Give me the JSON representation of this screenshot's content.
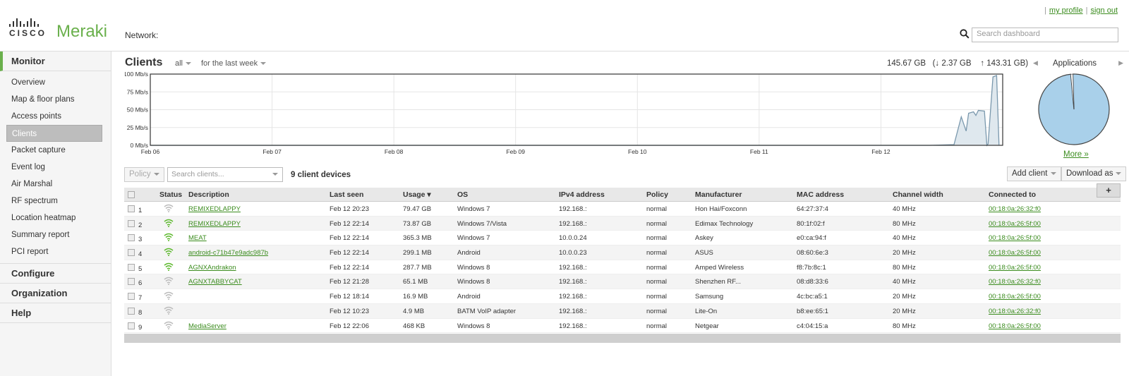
{
  "header": {
    "logo_word": "CISCO",
    "product": "Meraki",
    "network_label": "Network:",
    "my_profile": "my profile",
    "sign_out": "sign out",
    "search_placeholder": "Search dashboard"
  },
  "sidebar": {
    "monitor": "Monitor",
    "items": [
      {
        "label": "Overview"
      },
      {
        "label": "Map & floor plans"
      },
      {
        "label": "Access points"
      },
      {
        "label": "Clients",
        "active": true
      },
      {
        "label": "Packet capture"
      },
      {
        "label": "Event log"
      },
      {
        "label": "Air Marshal"
      },
      {
        "label": "RF spectrum"
      },
      {
        "label": "Location heatmap"
      },
      {
        "label": "Summary report"
      },
      {
        "label": "PCI report"
      }
    ],
    "configure": "Configure",
    "organization": "Organization",
    "help": "Help"
  },
  "main": {
    "title": "Clients",
    "filter_all": "all",
    "filter_time": "for the last week",
    "total_usage": "145.67 GB",
    "down_usage": "(↓ 2.37 GB",
    "up_usage": "↑ 143.31 GB)",
    "apps_title": "Applications",
    "more_link": "More »",
    "policy_btn": "Policy",
    "search_placeholder": "Search clients...",
    "client_count": "9 client devices",
    "add_client": "Add client",
    "download_as": "Download as"
  },
  "colors": {
    "accent": "#6ab04c",
    "link": "#3b8c1e",
    "chart_fill": "#dfe8ee",
    "chart_line": "#7a98ad",
    "pie_fill": "#a9d0ea"
  },
  "chart_data": {
    "type": "area",
    "ylabel_ticks": [
      "100 Mb/s",
      "75 Mb/s",
      "50 Mb/s",
      "25 Mb/s",
      "0 Mb/s"
    ],
    "ylim": [
      0,
      100
    ],
    "x_ticks": [
      "Feb 06",
      "Feb 07",
      "Feb 08",
      "Feb 09",
      "Feb 10",
      "Feb 11",
      "Feb 12"
    ],
    "x_range_days": [
      6.0,
      13.0
    ],
    "points": [
      {
        "day": 6.0,
        "mbps": 0
      },
      {
        "day": 12.4,
        "mbps": 0
      },
      {
        "day": 12.6,
        "mbps": 1
      },
      {
        "day": 12.66,
        "mbps": 40
      },
      {
        "day": 12.7,
        "mbps": 20
      },
      {
        "day": 12.72,
        "mbps": 45
      },
      {
        "day": 12.76,
        "mbps": 47
      },
      {
        "day": 12.78,
        "mbps": 42
      },
      {
        "day": 12.8,
        "mbps": 49
      },
      {
        "day": 12.85,
        "mbps": 48
      },
      {
        "day": 12.87,
        "mbps": 0
      },
      {
        "day": 12.88,
        "mbps": 2
      },
      {
        "day": 12.92,
        "mbps": 96
      },
      {
        "day": 12.95,
        "mbps": 98
      },
      {
        "day": 12.97,
        "mbps": 0
      }
    ],
    "grid": true
  },
  "apps_pie": {
    "type": "pie",
    "slices": [
      {
        "share": 0.99
      },
      {
        "share": 0.01
      }
    ]
  },
  "table": {
    "columns": [
      "Status",
      "Description",
      "Last seen",
      "Usage ▾",
      "OS",
      "IPv4 address",
      "Policy",
      "Manufacturer",
      "MAC address",
      "Channel width",
      "Connected to"
    ],
    "rows": [
      {
        "n": "1",
        "strength": "weak",
        "desc": "REMIXEDLAPPY",
        "last": "Feb 12 20:23",
        "usage": "79.47 GB",
        "os": "Windows 7",
        "ip": "192.168.:",
        "policy": "normal",
        "mfr": "Hon Hai/Foxconn",
        "mac": "64:27:37:4",
        "cw": "40 MHz",
        "ap": "00:18:0a:26:32:f0"
      },
      {
        "n": "2",
        "strength": "strong",
        "desc": "REMIXEDLAPPY",
        "last": "Feb 12 22:14",
        "usage": "73.87 GB",
        "os": "Windows 7/Vista",
        "ip": "192.168.:",
        "policy": "normal",
        "mfr": "Edimax Technology",
        "mac": "80:1f:02:f",
        "cw": "80 MHz",
        "ap": "00:18:0a:26:5f:00"
      },
      {
        "n": "3",
        "strength": "strong",
        "desc": "MEAT",
        "last": "Feb 12 22:14",
        "usage": "365.3 MB",
        "os": "Windows 7",
        "ip": "10.0.0.24",
        "policy": "normal",
        "mfr": "Askey",
        "mac": "e0:ca:94:f",
        "cw": "40 MHz",
        "ap": "00:18:0a:26:5f:00"
      },
      {
        "n": "4",
        "strength": "strong",
        "desc": "android-c71b47e9adc987b",
        "last": "Feb 12 22:14",
        "usage": "299.1 MB",
        "os": "Android",
        "ip": "10.0.0.23",
        "policy": "normal",
        "mfr": "ASUS",
        "mac": "08:60:6e:3",
        "cw": "20 MHz",
        "ap": "00:18:0a:26:5f:00"
      },
      {
        "n": "5",
        "strength": "strong",
        "desc": "AGNXAndrakon",
        "last": "Feb 12 22:14",
        "usage": "287.7 MB",
        "os": "Windows 8",
        "ip": "192.168.:",
        "policy": "normal",
        "mfr": "Amped Wireless",
        "mac": "f8:7b:8c:1",
        "cw": "80 MHz",
        "ap": "00:18:0a:26:5f:00"
      },
      {
        "n": "6",
        "strength": "weak",
        "desc": "AGNXTABBYCAT",
        "last": "Feb 12 21:28",
        "usage": "65.1 MB",
        "os": "Windows 8",
        "ip": "192.168.:",
        "policy": "normal",
        "mfr": "Shenzhen RF...",
        "mac": "08:d8:33:6",
        "cw": "40 MHz",
        "ap": "00:18:0a:26:32:f0"
      },
      {
        "n": "7",
        "strength": "weak",
        "desc": "",
        "last": "Feb 12 18:14",
        "usage": "16.9 MB",
        "os": "Android",
        "ip": "192.168.:",
        "policy": "normal",
        "mfr": "Samsung",
        "mac": "4c:bc:a5:1",
        "cw": "20 MHz",
        "ap": "00:18:0a:26:5f:00"
      },
      {
        "n": "8",
        "strength": "weak",
        "desc": "",
        "last": "Feb 12 10:23",
        "usage": "4.9 MB",
        "os": "BATM VoIP adapter",
        "ip": "192.168.:",
        "policy": "normal",
        "mfr": "Lite-On",
        "mac": "b8:ee:65:1",
        "cw": "20 MHz",
        "ap": "00:18:0a:26:32:f0"
      },
      {
        "n": "9",
        "strength": "weak",
        "desc": "MediaServer",
        "last": "Feb 12 22:06",
        "usage": "468 KB",
        "os": "Windows 8",
        "ip": "192.168.:",
        "policy": "normal",
        "mfr": "Netgear",
        "mac": "c4:04:15:a",
        "cw": "80 MHz",
        "ap": "00:18:0a:26:5f:00"
      }
    ]
  }
}
